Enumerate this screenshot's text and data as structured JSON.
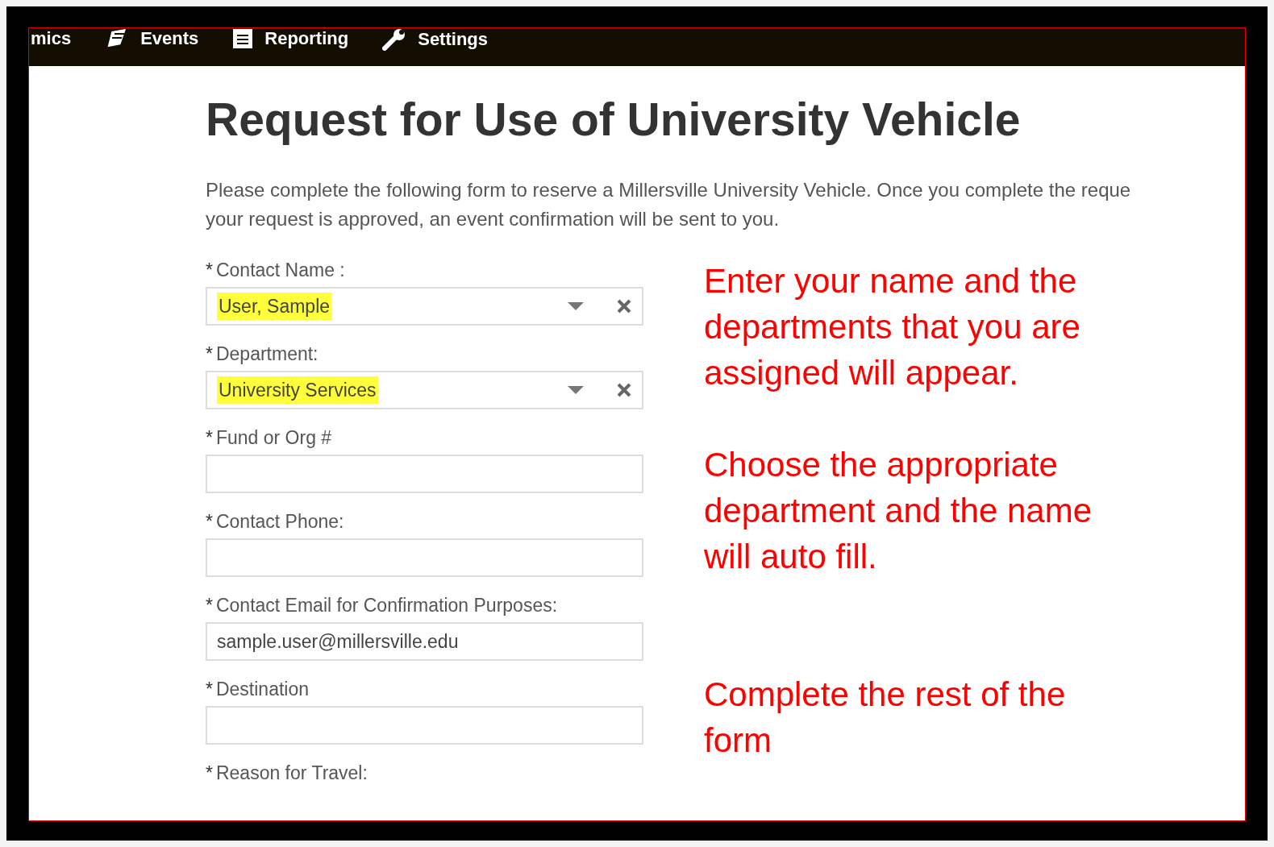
{
  "nav": {
    "items": [
      {
        "label": "mics"
      },
      {
        "label": "Events"
      },
      {
        "label": "Reporting"
      },
      {
        "label": "Settings"
      }
    ]
  },
  "title": "Request for Use of University Vehicle",
  "intro_lines": [
    "Please complete the following form to reserve a Millersville University Vehicle. Once you complete the reque",
    "your request is approved, an event confirmation will be sent to you."
  ],
  "fields": [
    {
      "required_mark": "*",
      "label": "Contact Name :",
      "kind": "select",
      "value": "User, Sample",
      "highlighted": true
    },
    {
      "required_mark": "*",
      "label": "Department:",
      "kind": "select",
      "value": "University Services",
      "highlighted": true
    },
    {
      "required_mark": "*",
      "label": "Fund or Org #",
      "kind": "text"
    },
    {
      "required_mark": "*",
      "label": "Contact Phone:",
      "kind": "text"
    },
    {
      "required_mark": "*",
      "label": "Contact Email for Confirmation Purposes:",
      "kind": "text",
      "value": "sample.user@millersville.edu",
      "highlighted": false
    },
    {
      "required_mark": "*",
      "label": "Destination",
      "kind": "text"
    },
    {
      "required_mark": "*",
      "label": "Reason for Travel:",
      "kind": "label_only"
    }
  ],
  "annotations": [
    "Enter your name and the departments that you are assigned will appear.",
    "Choose the appropriate department and the name will auto fill.",
    "Complete the rest of the form"
  ]
}
